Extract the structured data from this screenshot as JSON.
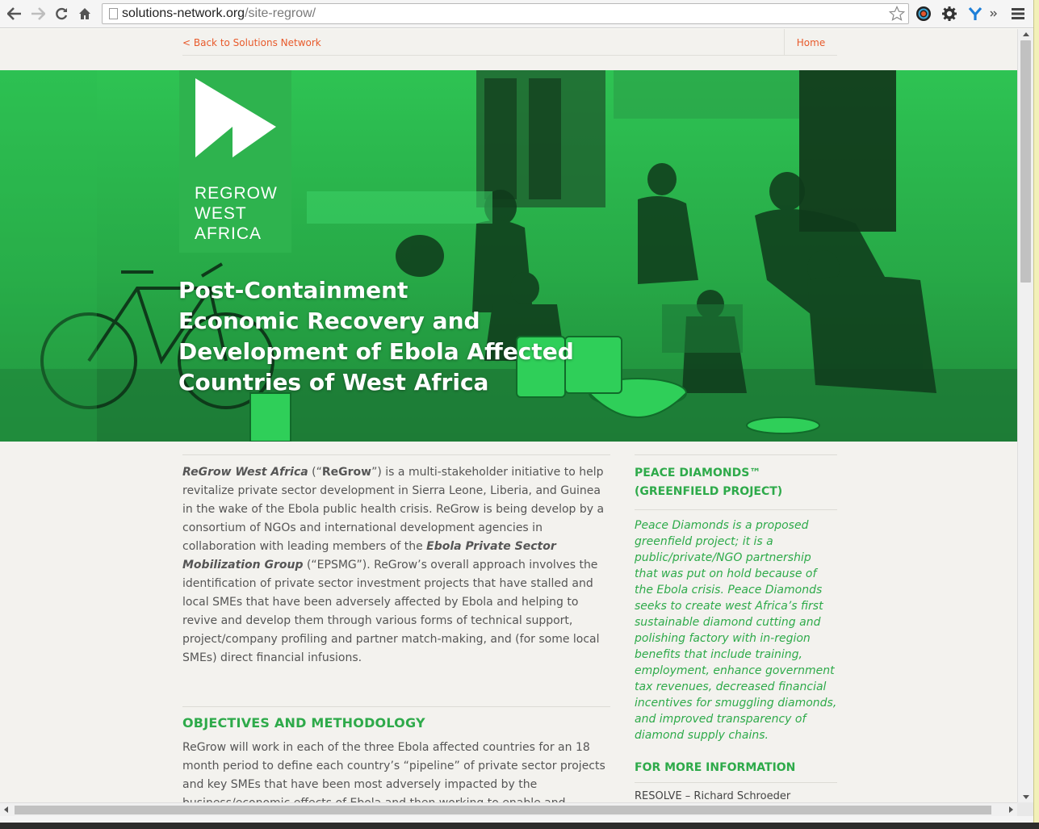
{
  "browser": {
    "url_domain": "solutions-network.org",
    "url_path": "/site-regrow/"
  },
  "topnav": {
    "back_label": "< Back to Solutions Network",
    "home_label": "Home"
  },
  "hero": {
    "logo_line1": "REGROW",
    "logo_line2": "WEST",
    "logo_line3": "AFRICA",
    "title_line1": "Post-Containment",
    "title_line2": "Economic Recovery and",
    "title_line3": "Development of Ebola Affected",
    "title_line4": "Countries of West Africa"
  },
  "intro": {
    "org_name": "ReGrow West Africa",
    "p1": " (“",
    "short_name": "ReGrow",
    "p2": "”) is a multi-stakeholder initiative to help revitalize private sector development in Sierra Leone, Liberia, and Guinea in the wake of the Ebola public health crisis. ReGrow is being develop by a consortium of NGOs and international development agencies in collaboration with leading members of the ",
    "group_name": "Ebola Private Sector Mobilization Group",
    "p3": " (“EPSMG”). ReGrow’s overall approach involves the identification of private sector investment projects that have stalled and local SMEs that have been adversely affected by Ebola and helping to revive and develop them through various forms of technical support, project/company profiling and partner match-making, and (for some local SMEs) direct financial infusions."
  },
  "objectives": {
    "title": "OBJECTIVES AND METHODOLOGY",
    "text": "ReGrow will work in each of the three Ebola affected countries for an 18 month period to define each country’s “pipeline” of private sector projects and key SMEs that have been most adversely impacted by the business/economic effects of Ebola and then working to enable and support the them. This work will include:"
  },
  "sidebar": {
    "title_line1": "PEACE DIAMONDS™",
    "title_line2": "(GREENFIELD PROJECT)",
    "text": "Peace Diamonds is a proposed greenfield project; it is a public/private/NGO partnership that was put on hold because of the Ebola crisis. Peace Diamonds seeks to create west Africa’s first sustainable diamond cutting and polishing factory with in-region benefits that include training, employment, enhance government tax revenues, decreased financial incentives for smuggling diamonds, and improved transparency of diamond supply chains.",
    "more_title": "FOR MORE INFORMATION",
    "contact": "RESOLVE – Richard Schroeder"
  },
  "colors": {
    "brand_green": "#2eaa4a",
    "hero_green": "#2bb94d",
    "link_orange": "#e85a2b"
  },
  "icons": [
    "back-arrow-icon",
    "forward-arrow-icon",
    "reload-icon",
    "home-icon",
    "page-icon",
    "star-icon",
    "color-wheel-icon",
    "gear-icon",
    "y-extension-icon",
    "overflow-chevron-icon",
    "menu-icon",
    "regrow-play-logo"
  ]
}
